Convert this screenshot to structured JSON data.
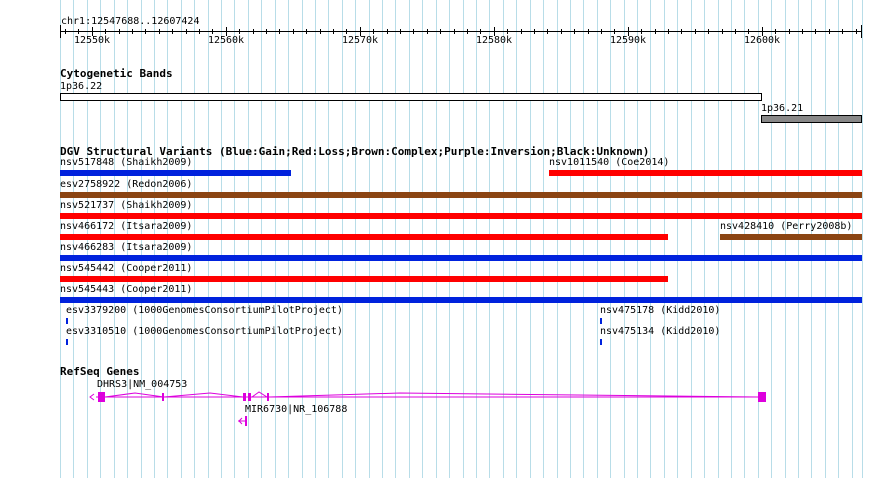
{
  "ruler": {
    "title": "chr1:12547688..12607424",
    "ticks": [
      "12550k",
      "12560k",
      "12570k",
      "12580k",
      "12590k",
      "12600k"
    ]
  },
  "cytoband": {
    "title": "Cytogenetic Bands",
    "bands": [
      {
        "label": "1p36.22",
        "color": "#ffffff"
      },
      {
        "label": "1p36.21",
        "color": "#888888"
      }
    ]
  },
  "dgv": {
    "title": "DGV Structural Variants (Blue:Gain;Red:Loss;Brown:Complex;Purple:Inversion;Black:Unknown)",
    "colors": {
      "gain": "#0022dd",
      "loss": "#ff0000",
      "complex": "#8b4513"
    },
    "variants": [
      {
        "label": "nsv517848 (Shaikh2009)",
        "type": "gain"
      },
      {
        "label": "nsv1011540 (Coe2014)",
        "type": "loss"
      },
      {
        "label": "esv2758922 (Redon2006)",
        "type": "complex"
      },
      {
        "label": "nsv521737 (Shaikh2009)",
        "type": "loss"
      },
      {
        "label": "nsv466172 (Itsara2009)",
        "type": "loss"
      },
      {
        "label": "nsv428410 (Perry2008b)",
        "type": "complex"
      },
      {
        "label": "nsv466283 (Itsara2009)",
        "type": "gain"
      },
      {
        "label": "nsv545442 (Cooper2011)",
        "type": "loss"
      },
      {
        "label": "nsv545443 (Cooper2011)",
        "type": "gain"
      },
      {
        "label": "esv3379200 (1000GenomesConsortiumPilotProject)",
        "type": "gain"
      },
      {
        "label": "nsv475178 (Kidd2010)",
        "type": "gain"
      },
      {
        "label": "esv3310510 (1000GenomesConsortiumPilotProject)",
        "type": "gain"
      },
      {
        "label": "nsv475134 (Kidd2010)",
        "type": "gain"
      }
    ]
  },
  "genes": {
    "title": "RefSeq Genes",
    "color": "#dd00dd",
    "items": [
      {
        "label": "DHRS3|NM_004753",
        "strand": "-"
      },
      {
        "label": "MIR6730|NR_106788",
        "strand": "-"
      }
    ]
  }
}
